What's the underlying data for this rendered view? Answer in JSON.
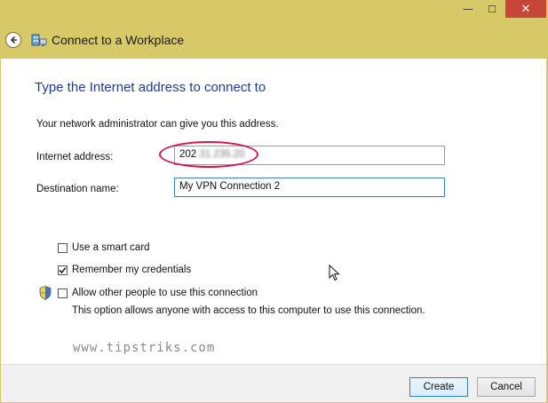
{
  "window": {
    "controls": {
      "minimize": "—",
      "maximize": "☐",
      "close": "✕"
    },
    "title": "Connect to a Workplace"
  },
  "page": {
    "heading": "Type the Internet address to connect to",
    "description": "Your network administrator can give you this address."
  },
  "form": {
    "internet_address": {
      "label": "Internet address:",
      "value_visible": "202",
      "value_obscured": ".31.235.20"
    },
    "destination_name": {
      "label": "Destination name:",
      "value": "My VPN Connection 2"
    }
  },
  "options": {
    "smart_card": {
      "label": "Use a smart card",
      "checked": false
    },
    "remember_credentials": {
      "label": "Remember my credentials",
      "checked": true
    },
    "allow_others": {
      "label": "Allow other people to use this connection",
      "checked": false,
      "note": "This option allows anyone with access to this computer to use this connection."
    }
  },
  "watermark": "www.tipstriks.com",
  "buttons": {
    "create": "Create",
    "cancel": "Cancel"
  },
  "colors": {
    "titlebar": "#d8c968",
    "heading": "#1f3d8c",
    "highlight_oval": "#d6154f",
    "close": "#c7463a"
  }
}
